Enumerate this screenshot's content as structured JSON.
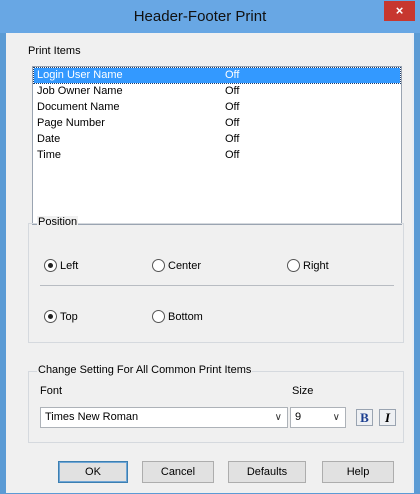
{
  "window": {
    "title": "Header-Footer Print",
    "close_label": "×"
  },
  "print_items": {
    "label": "Print Items",
    "rows": [
      {
        "name": "Login User Name",
        "value": "Off",
        "selected": true
      },
      {
        "name": "Job Owner Name",
        "value": "Off"
      },
      {
        "name": "Document Name",
        "value": "Off"
      },
      {
        "name": "Page Number",
        "value": "Off"
      },
      {
        "name": "Date",
        "value": "Off"
      },
      {
        "name": "Time",
        "value": "Off"
      }
    ]
  },
  "position": {
    "label": "Position",
    "horizontal": [
      {
        "label": "Left",
        "checked": true
      },
      {
        "label": "Center",
        "checked": false
      },
      {
        "label": "Right",
        "checked": false
      }
    ],
    "vertical": [
      {
        "label": "Top",
        "checked": true
      },
      {
        "label": "Bottom",
        "checked": false
      }
    ]
  },
  "common_settings": {
    "label": "Change Setting For All Common Print Items",
    "font_label": "Font",
    "size_label": "Size",
    "font_value": "Times New Roman",
    "size_value": "9",
    "bold_label": "B",
    "italic_label": "I"
  },
  "buttons": {
    "ok": "OK",
    "cancel": "Cancel",
    "defaults": "Defaults",
    "help": "Help"
  }
}
